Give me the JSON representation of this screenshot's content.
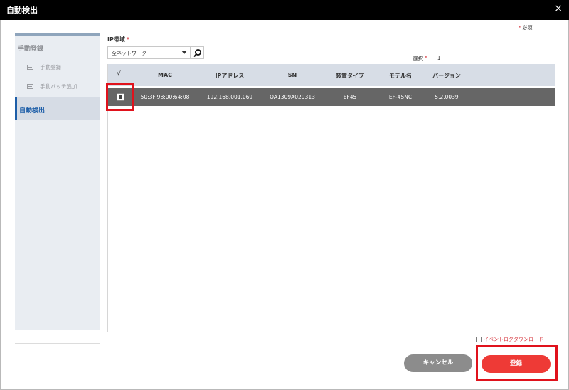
{
  "window": {
    "title": "自動検出",
    "close_icon": "×"
  },
  "sidebar": {
    "group_label": "手動登録",
    "items": [
      {
        "label": "手動登録",
        "icon": "list-icon"
      },
      {
        "label": "手動バッチ追加",
        "icon": "batch-icon"
      }
    ],
    "active_item": "自動検出"
  },
  "form": {
    "ip_label": "IP帯域",
    "required_mark": "*",
    "required_note": "必須",
    "ip_select_value": "全ネットワーク",
    "select_label": "選択",
    "select_count": "1"
  },
  "table": {
    "check_header": "√",
    "columns": [
      "MAC",
      "IPアドレス",
      "SN",
      "装置タイプ",
      "モデル名",
      "バージョン"
    ],
    "rows": [
      {
        "selected": true,
        "mac": "50:3F:98:00:64:08",
        "ip": "192.168.001.069",
        "sn": "OA1309A029313",
        "type": "EF45",
        "model": "EF-45NC",
        "version": "5.2.0039"
      }
    ]
  },
  "footer": {
    "event_log_label": "イベントログダウンロード",
    "cancel_label": "キャンセル",
    "register_label": "登録"
  },
  "colors": {
    "titlebar": "#000000",
    "sidebar_bg": "#e9edf2",
    "active_accent": "#1d5ea8",
    "table_header": "#d7dde6",
    "selected_row": "#666666",
    "primary_button": "#ee3a36",
    "secondary_button": "#8c8c8c",
    "highlight": "#e0121c"
  }
}
